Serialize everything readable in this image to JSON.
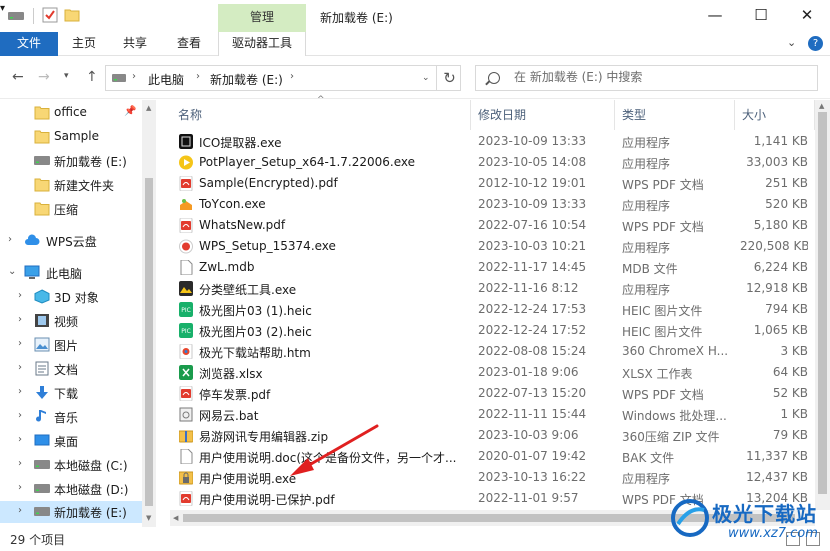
{
  "titlebar": {
    "context_tab": "管理",
    "title": "新加载卷 (E:)",
    "minimize": "—",
    "maximize": "☐",
    "close": "✕"
  },
  "ribbon": {
    "tabs": [
      "文件",
      "主页",
      "共享",
      "查看",
      "驱动器工具"
    ],
    "help": "?"
  },
  "address": {
    "crumbs": [
      "此电脑",
      "新加载卷 (E:)"
    ]
  },
  "search": {
    "placeholder": "在 新加载卷 (E:) 中搜索"
  },
  "sidebar": {
    "items": [
      {
        "label": "office",
        "icon": "folder-icon",
        "pinned": true
      },
      {
        "label": "Sample",
        "icon": "folder-icon"
      },
      {
        "label": "新加载卷 (E:)",
        "icon": "drive-icon"
      },
      {
        "label": "新建文件夹",
        "icon": "folder-icon"
      },
      {
        "label": "压缩",
        "icon": "folder-icon"
      },
      {
        "label": "WPS云盘",
        "icon": "cloud-icon"
      },
      {
        "label": "此电脑",
        "icon": "computer-icon"
      },
      {
        "label": "3D 对象",
        "icon": "cube-icon"
      },
      {
        "label": "视频",
        "icon": "video-icon"
      },
      {
        "label": "图片",
        "icon": "picture-icon"
      },
      {
        "label": "文档",
        "icon": "document-icon"
      },
      {
        "label": "下载",
        "icon": "download-icon"
      },
      {
        "label": "音乐",
        "icon": "music-icon"
      },
      {
        "label": "桌面",
        "icon": "desktop-icon"
      },
      {
        "label": "本地磁盘 (C:)",
        "icon": "drive-icon"
      },
      {
        "label": "本地磁盘 (D:)",
        "icon": "drive-icon"
      },
      {
        "label": "新加载卷 (E:)",
        "icon": "drive-icon"
      }
    ]
  },
  "columns": {
    "name": "名称",
    "date": "修改日期",
    "type": "类型",
    "size": "大小"
  },
  "files": [
    {
      "name": "ICO提取器.exe",
      "date": "2023-10-09 13:33",
      "type": "应用程序",
      "size": "1,141 KB",
      "icon": "app-black-icon"
    },
    {
      "name": "PotPlayer_Setup_x64-1.7.22006.exe",
      "date": "2023-10-05 14:08",
      "type": "应用程序",
      "size": "33,003 KB",
      "icon": "potplayer-icon"
    },
    {
      "name": "Sample(Encrypted).pdf",
      "date": "2012-10-12 19:01",
      "type": "WPS PDF 文档",
      "size": "251 KB",
      "icon": "pdf-icon"
    },
    {
      "name": "ToYcon.exe",
      "date": "2023-10-09 13:33",
      "type": "应用程序",
      "size": "520 KB",
      "icon": "toycon-icon"
    },
    {
      "name": "WhatsNew.pdf",
      "date": "2022-07-16 10:54",
      "type": "WPS PDF 文档",
      "size": "5,180 KB",
      "icon": "pdf-icon"
    },
    {
      "name": "WPS_Setup_15374.exe",
      "date": "2023-10-03 10:21",
      "type": "应用程序",
      "size": "220,508 KB",
      "icon": "wps-icon"
    },
    {
      "name": "ZwL.mdb",
      "date": "2022-11-17 14:45",
      "type": "MDB 文件",
      "size": "6,224 KB",
      "icon": "blank-file-icon"
    },
    {
      "name": "分类壁纸工具.exe",
      "date": "2022-11-16 8:12",
      "type": "应用程序",
      "size": "12,918 KB",
      "icon": "wallpaper-app-icon"
    },
    {
      "name": "极光图片03 (1).heic",
      "date": "2022-12-24 17:53",
      "type": "HEIC 图片文件",
      "size": "794 KB",
      "icon": "heic-icon"
    },
    {
      "name": "极光图片03 (2).heic",
      "date": "2022-12-24 17:52",
      "type": "HEIC 图片文件",
      "size": "1,065 KB",
      "icon": "heic-icon"
    },
    {
      "name": "极光下载站帮助.htm",
      "date": "2022-08-08 15:24",
      "type": "360 ChromeX H...",
      "size": "3 KB",
      "icon": "html-icon"
    },
    {
      "name": "浏览器.xlsx",
      "date": "2023-01-18 9:06",
      "type": "XLSX 工作表",
      "size": "64 KB",
      "icon": "excel-icon"
    },
    {
      "name": "停车发票.pdf",
      "date": "2022-07-13 15:20",
      "type": "WPS PDF 文档",
      "size": "52 KB",
      "icon": "pdf-icon"
    },
    {
      "name": "网易云.bat",
      "date": "2022-11-11 15:44",
      "type": "Windows 批处理...",
      "size": "1 KB",
      "icon": "bat-icon"
    },
    {
      "name": "易游网讯专用编辑器.zip",
      "date": "2023-10-03 9:06",
      "type": "360压缩 ZIP 文件",
      "size": "79 KB",
      "icon": "zip-icon"
    },
    {
      "name": "用户使用说明.doc(这个是备份文件，另一个才...",
      "date": "2020-01-07 19:42",
      "type": "BAK 文件",
      "size": "11,337 KB",
      "icon": "blank-file-icon"
    },
    {
      "name": "用户使用说明.exe",
      "date": "2023-10-13 16:22",
      "type": "应用程序",
      "size": "12,437 KB",
      "icon": "lock-app-icon"
    },
    {
      "name": "用户使用说明-已保护.pdf",
      "date": "2022-11-01 9:57",
      "type": "WPS PDF 文档",
      "size": "13,204 KB",
      "icon": "pdf-icon"
    }
  ],
  "status": {
    "count": "29 个项目"
  },
  "watermark": {
    "title": "极光下载站",
    "url": "www.xz7.com"
  },
  "colors": {
    "accent": "#1f6cc0",
    "context_tab": "#d4ecc2",
    "selection": "#cce8ff",
    "annotation": "#e02020"
  }
}
